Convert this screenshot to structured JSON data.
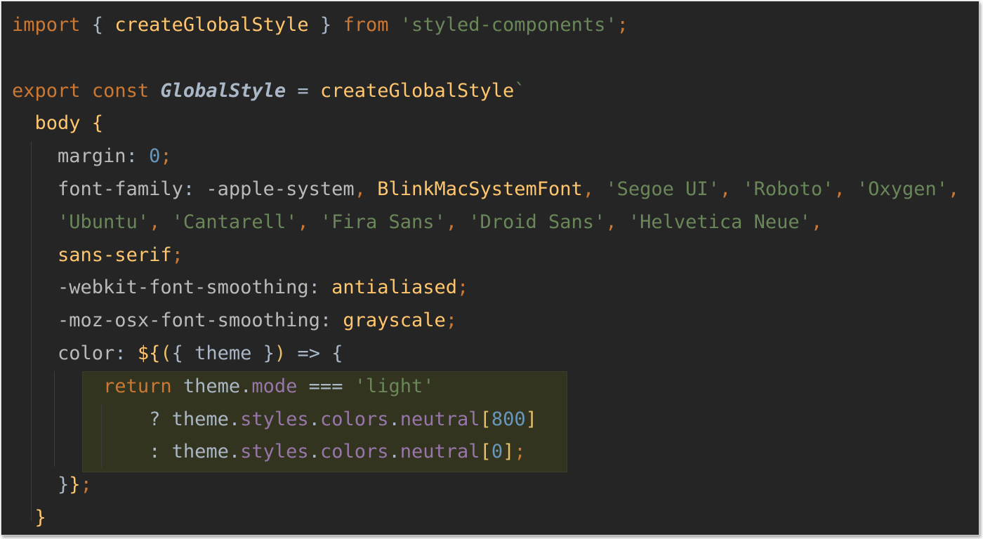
{
  "code": {
    "lines": [
      {
        "tokens": [
          {
            "t": "import",
            "c": "kw"
          },
          {
            "t": " { ",
            "c": "plain"
          },
          {
            "t": "createGlobalStyle",
            "c": "fn"
          },
          {
            "t": " } ",
            "c": "plain"
          },
          {
            "t": "from",
            "c": "kw"
          },
          {
            "t": " ",
            "c": "plain"
          },
          {
            "t": "'styled-components'",
            "c": "str"
          },
          {
            "t": ";",
            "c": "kw"
          }
        ]
      },
      {
        "tokens": []
      },
      {
        "tokens": [
          {
            "t": "export",
            "c": "kw"
          },
          {
            "t": " ",
            "c": "plain"
          },
          {
            "t": "const",
            "c": "kw"
          },
          {
            "t": " ",
            "c": "plain"
          },
          {
            "t": "GlobalStyle",
            "c": "italic"
          },
          {
            "t": " = ",
            "c": "plain"
          },
          {
            "t": "createGlobalStyle",
            "c": "fn"
          },
          {
            "t": "`",
            "c": "str"
          }
        ]
      },
      {
        "tokens": [
          {
            "t": "  ",
            "c": "plain"
          },
          {
            "t": "body",
            "c": "fn"
          },
          {
            "t": " {",
            "c": "fn"
          }
        ]
      },
      {
        "tokens": [
          {
            "t": "    ",
            "c": "plain"
          },
          {
            "t": "margin",
            "c": "prop"
          },
          {
            "t": ": ",
            "c": "plain"
          },
          {
            "t": "0",
            "c": "num"
          },
          {
            "t": ";",
            "c": "kw"
          }
        ]
      },
      {
        "tokens": [
          {
            "t": "    ",
            "c": "plain"
          },
          {
            "t": "font-family",
            "c": "prop"
          },
          {
            "t": ": ",
            "c": "plain"
          },
          {
            "t": "-apple-system",
            "c": "prop"
          },
          {
            "t": ", ",
            "c": "kw"
          },
          {
            "t": "BlinkMacSystemFont",
            "c": "fn"
          },
          {
            "t": ", ",
            "c": "kw"
          },
          {
            "t": "'Segoe UI'",
            "c": "str"
          },
          {
            "t": ", ",
            "c": "kw"
          },
          {
            "t": "'Roboto'",
            "c": "str"
          },
          {
            "t": ", ",
            "c": "kw"
          },
          {
            "t": "'Oxygen'",
            "c": "str"
          },
          {
            "t": ",",
            "c": "kw"
          }
        ]
      },
      {
        "tokens": [
          {
            "t": "    ",
            "c": "plain"
          },
          {
            "t": "'Ubuntu'",
            "c": "str"
          },
          {
            "t": ", ",
            "c": "kw"
          },
          {
            "t": "'Cantarell'",
            "c": "str"
          },
          {
            "t": ", ",
            "c": "kw"
          },
          {
            "t": "'Fira Sans'",
            "c": "str"
          },
          {
            "t": ", ",
            "c": "kw"
          },
          {
            "t": "'Droid Sans'",
            "c": "str"
          },
          {
            "t": ", ",
            "c": "kw"
          },
          {
            "t": "'Helvetica Neue'",
            "c": "str"
          },
          {
            "t": ",",
            "c": "kw"
          }
        ]
      },
      {
        "tokens": [
          {
            "t": "    ",
            "c": "plain"
          },
          {
            "t": "sans-serif",
            "c": "fn"
          },
          {
            "t": ";",
            "c": "kw"
          }
        ]
      },
      {
        "tokens": [
          {
            "t": "    ",
            "c": "plain"
          },
          {
            "t": "-webkit-font-smoothing",
            "c": "prop"
          },
          {
            "t": ": ",
            "c": "plain"
          },
          {
            "t": "antialiased",
            "c": "fn"
          },
          {
            "t": ";",
            "c": "kw"
          }
        ]
      },
      {
        "tokens": [
          {
            "t": "    ",
            "c": "plain"
          },
          {
            "t": "-moz-osx-font-smoothing",
            "c": "prop"
          },
          {
            "t": ": ",
            "c": "plain"
          },
          {
            "t": "grayscale",
            "c": "fn"
          },
          {
            "t": ";",
            "c": "kw"
          }
        ]
      },
      {
        "tokens": [
          {
            "t": "    ",
            "c": "plain"
          },
          {
            "t": "color",
            "c": "prop"
          },
          {
            "t": ": ",
            "c": "plain"
          },
          {
            "t": "${",
            "c": "fn"
          },
          {
            "t": "(",
            "c": "brace"
          },
          {
            "t": "{ ",
            "c": "plain"
          },
          {
            "t": "theme",
            "c": "plain"
          },
          {
            "t": " }",
            "c": "plain"
          },
          {
            "t": ")",
            "c": "brace"
          },
          {
            "t": " => ",
            "c": "plain"
          },
          {
            "t": "{",
            "c": "plain"
          }
        ]
      },
      {
        "tokens": [
          {
            "t": "        ",
            "c": "plain"
          },
          {
            "t": "return",
            "c": "kw"
          },
          {
            "t": " theme.",
            "c": "plain"
          },
          {
            "t": "mode",
            "c": "field"
          },
          {
            "t": " === ",
            "c": "plain"
          },
          {
            "t": "'light'",
            "c": "str"
          }
        ]
      },
      {
        "tokens": [
          {
            "t": "            ",
            "c": "plain"
          },
          {
            "t": "? theme.",
            "c": "plain"
          },
          {
            "t": "styles",
            "c": "field"
          },
          {
            "t": ".",
            "c": "plain"
          },
          {
            "t": "colors",
            "c": "field"
          },
          {
            "t": ".",
            "c": "plain"
          },
          {
            "t": "neutral",
            "c": "field"
          },
          {
            "t": "[",
            "c": "brace"
          },
          {
            "t": "800",
            "c": "num"
          },
          {
            "t": "]",
            "c": "brace"
          }
        ]
      },
      {
        "tokens": [
          {
            "t": "            ",
            "c": "plain"
          },
          {
            "t": ": theme.",
            "c": "plain"
          },
          {
            "t": "styles",
            "c": "field"
          },
          {
            "t": ".",
            "c": "plain"
          },
          {
            "t": "colors",
            "c": "field"
          },
          {
            "t": ".",
            "c": "plain"
          },
          {
            "t": "neutral",
            "c": "field"
          },
          {
            "t": "[",
            "c": "brace"
          },
          {
            "t": "0",
            "c": "num"
          },
          {
            "t": "]",
            "c": "brace"
          },
          {
            "t": ";",
            "c": "kw"
          }
        ]
      },
      {
        "tokens": [
          {
            "t": "    ",
            "c": "plain"
          },
          {
            "t": "}",
            "c": "plain"
          },
          {
            "t": "}",
            "c": "fn"
          },
          {
            "t": ";",
            "c": "kw"
          }
        ]
      },
      {
        "tokens": [
          {
            "t": "  ",
            "c": "plain"
          },
          {
            "t": "}",
            "c": "fn"
          }
        ]
      }
    ]
  },
  "colors": {
    "background": "#252525",
    "keyword": "#cc7832",
    "string": "#6a8759",
    "function": "#ffc66d",
    "number": "#6897bb",
    "field": "#9876aa",
    "highlight": "#32341f"
  }
}
